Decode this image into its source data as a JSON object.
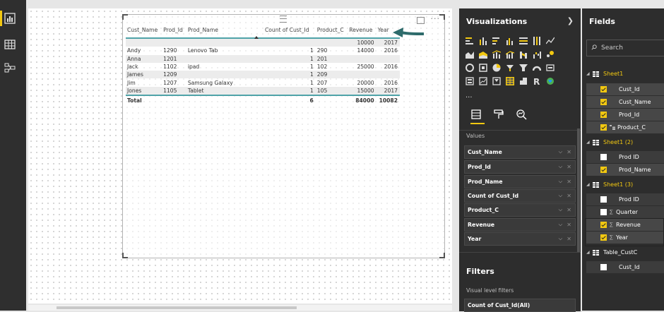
{
  "table_visual": {
    "columns": [
      "Cust_Name",
      "Prod_Id",
      "Prod_Name",
      "Count of Cust_Id",
      "Product_C",
      "Revenue",
      "Year"
    ],
    "rows": [
      [
        "",
        "",
        "",
        "",
        "",
        "10000",
        "2017"
      ],
      [
        "Andy",
        "1290",
        "Lenovo Tab",
        "1",
        "290",
        "14000",
        "2016"
      ],
      [
        "Anna",
        "1201",
        "",
        "1",
        "201",
        "",
        ""
      ],
      [
        "Jack",
        "1102",
        "ipad",
        "1",
        "102",
        "25000",
        "2016"
      ],
      [
        "James",
        "1209",
        "",
        "1",
        "209",
        "",
        ""
      ],
      [
        "Jim",
        "1207",
        "Samsung Galaxy",
        "1",
        "207",
        "20000",
        "2016"
      ],
      [
        "Jones",
        "1105",
        "Tablet",
        "1",
        "105",
        "15000",
        "2017"
      ]
    ],
    "total": [
      "Total",
      "",
      "",
      "6",
      "",
      "84000",
      "10082"
    ]
  },
  "visualizations": {
    "title": "Visualizations",
    "values_label": "Values",
    "wells": [
      "Cust_Name",
      "Prod_Id",
      "Prod_Name",
      "Count of Cust_Id",
      "Product_C",
      "Revenue",
      "Year"
    ],
    "more": "...",
    "filters_title": "Filters",
    "visual_level_filters": "Visual level filters",
    "filter_item": "Count of Cust_Id(All)"
  },
  "fields": {
    "title": "Fields",
    "search_placeholder": "Search",
    "tables": [
      {
        "name": "Sheet1",
        "highlighted": true,
        "items": [
          {
            "label": "Cust_Id",
            "checked": true,
            "sigma": false
          },
          {
            "label": "Cust_Name",
            "checked": true,
            "sigma": false
          },
          {
            "label": "Prod_Id",
            "checked": true,
            "sigma": false
          },
          {
            "label": "Product_C",
            "checked": true,
            "sigma": false
          }
        ]
      },
      {
        "name": "Sheet1 (2)",
        "highlighted": true,
        "items": [
          {
            "label": "Prod ID",
            "checked": false,
            "sigma": false
          },
          {
            "label": "Prod_Name",
            "checked": true,
            "sigma": false
          }
        ]
      },
      {
        "name": "Sheet1 (3)",
        "highlighted": true,
        "items": [
          {
            "label": "Prod ID",
            "checked": false,
            "sigma": false
          },
          {
            "label": "Quarter",
            "checked": false,
            "sigma": true
          },
          {
            "label": "Revenue",
            "checked": true,
            "sigma": true
          },
          {
            "label": "Year",
            "checked": true,
            "sigma": true
          }
        ]
      },
      {
        "name": "Table_CustC",
        "highlighted": false,
        "items": [
          {
            "label": "Cust_Id",
            "checked": false,
            "sigma": false
          }
        ]
      }
    ]
  },
  "colors": {
    "accent": "#f2c811",
    "teal": "#4fa3a8",
    "arrow": "#2e6b6b",
    "panel": "#2d2d2d"
  }
}
